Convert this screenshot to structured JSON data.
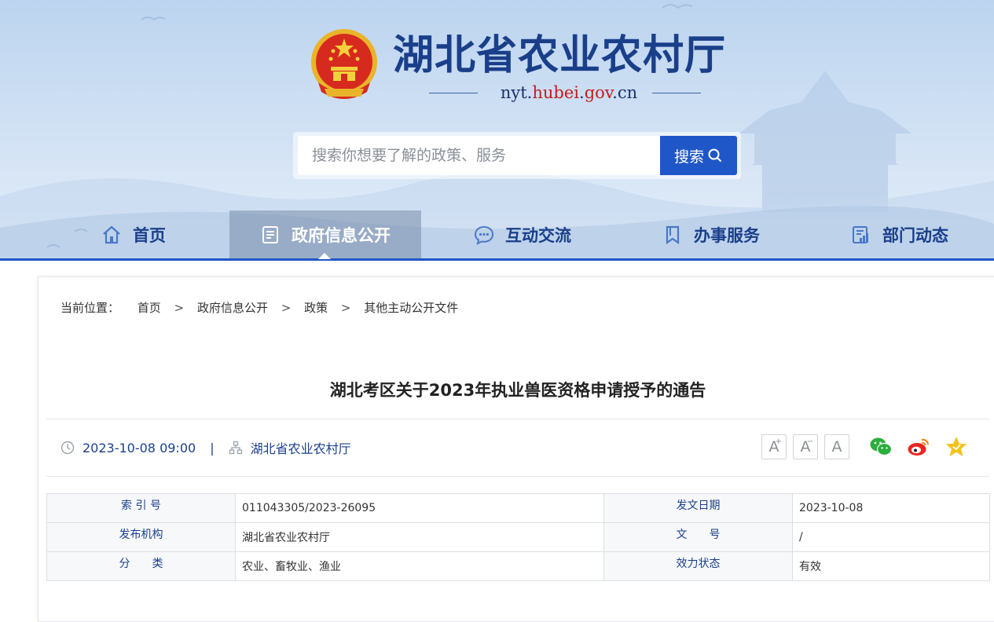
{
  "header": {
    "site_title": "湖北省农业农村厅",
    "domain_prefix": "nyt.",
    "domain_highlight": "hubei",
    "domain_dot": ".",
    "domain_gov": "gov",
    "domain_suffix": ".cn"
  },
  "search": {
    "placeholder": "搜索你想要了解的政策、服务",
    "button_label": "搜索"
  },
  "nav": {
    "items": [
      {
        "label": "首页",
        "icon": "home-icon"
      },
      {
        "label": "政府信息公开",
        "icon": "document-list-icon",
        "active": true
      },
      {
        "label": "互动交流",
        "icon": "chat-bubble-icon"
      },
      {
        "label": "办事服务",
        "icon": "bookmark-icon"
      },
      {
        "label": "部门动态",
        "icon": "news-chart-icon"
      }
    ]
  },
  "breadcrumb": {
    "prefix": "当前位置：",
    "items": [
      "首页",
      "政府信息公开",
      "政策",
      "其他主动公开文件"
    ],
    "separator": ">"
  },
  "article": {
    "title": "湖北考区关于2023年执业兽医资格申请授予的通告",
    "datetime": "2023-10-08 09:00",
    "divider": "|",
    "source": "湖北省农业农村厅"
  },
  "font_controls": [
    "A",
    "A",
    "A"
  ],
  "share": [
    "wechat-icon",
    "weibo-icon",
    "favorite-star-icon"
  ],
  "info_table": {
    "rows": [
      {
        "k1": "索 引 号",
        "v1": "011043305/2023-26095",
        "k2": "发文日期",
        "v2": "2023-10-08"
      },
      {
        "k1": "发布机构",
        "v1": "湖北省农业农村厅",
        "k2": "文　　号",
        "v2": "/"
      },
      {
        "k1": "分　　类",
        "v1": "农业、畜牧业、渔业",
        "k2": "效力状态",
        "v2": "有效"
      }
    ]
  },
  "colors": {
    "brand_blue": "#1f57c8",
    "title_blue": "#1a3f8a",
    "domain_red": "#c81a1a"
  }
}
